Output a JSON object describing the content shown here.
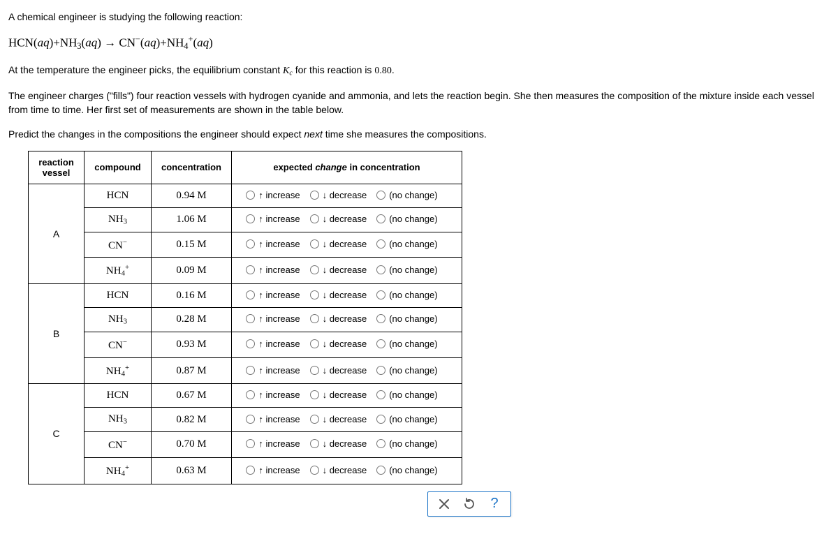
{
  "intro": {
    "line1": "A chemical engineer is studying the following reaction:",
    "equation_html": "HCN<span class='plain'>(</span><span class='ital'>aq</span><span class='plain'>)</span>+NH<sub>3</sub><span class='plain'>(</span><span class='ital'>aq</span><span class='plain'>)</span> &rarr; CN<sup>&minus;</sup><span class='plain'>(</span><span class='ital'>aq</span><span class='plain'>)</span>+NH<sub>4</sub><sup>+</sup><span class='plain'>(</span><span class='ital'>aq</span><span class='plain'>)</span>",
    "line2_pre": "At the temperature the engineer picks, the equilibrium constant ",
    "line2_k": "K",
    "line2_ksub": "c",
    "line2_post": " for this reaction is ",
    "kc_value": "0.80",
    "line2_end": ".",
    "line3": "The engineer charges (\"fills\") four reaction vessels with hydrogen cyanide and ammonia, and lets the reaction begin. She then measures the composition of the mixture inside each vessel from time to time. Her first set of measurements are shown in the table below.",
    "line4_pre": "Predict the changes in the compositions the engineer should expect ",
    "line4_em": "next",
    "line4_post": " time she measures the compositions."
  },
  "headers": {
    "vessel_l1": "reaction",
    "vessel_l2": "vessel",
    "compound": "compound",
    "concentration": "concentration",
    "change_pre": "expected ",
    "change_em": "change",
    "change_post": " in concentration"
  },
  "options": {
    "increase": "↑ increase",
    "decrease": "↓ decrease",
    "nochange": "(no change)"
  },
  "compounds": {
    "hcn": "HCN",
    "nh3": "NH<sub>3</sub>",
    "cn": "CN<sup>&minus;</sup>",
    "nh4": "NH<sub>4</sub><sup>+</sup>"
  },
  "vessels": {
    "A": {
      "label": "A",
      "rows": [
        {
          "compound_key": "hcn",
          "conc": "0.94 M"
        },
        {
          "compound_key": "nh3",
          "conc": "1.06 M"
        },
        {
          "compound_key": "cn",
          "conc": "0.15 M"
        },
        {
          "compound_key": "nh4",
          "conc": "0.09 M"
        }
      ]
    },
    "B": {
      "label": "B",
      "rows": [
        {
          "compound_key": "hcn",
          "conc": "0.16 M"
        },
        {
          "compound_key": "nh3",
          "conc": "0.28 M"
        },
        {
          "compound_key": "cn",
          "conc": "0.93 M"
        },
        {
          "compound_key": "nh4",
          "conc": "0.87 M"
        }
      ]
    },
    "C": {
      "label": "C",
      "rows": [
        {
          "compound_key": "hcn",
          "conc": "0.67 M"
        },
        {
          "compound_key": "nh3",
          "conc": "0.82 M"
        },
        {
          "compound_key": "cn",
          "conc": "0.70 M"
        },
        {
          "compound_key": "nh4",
          "conc": "0.63 M"
        }
      ]
    }
  },
  "buttons": {
    "clear": "clear",
    "reset": "reset",
    "help": "help"
  }
}
